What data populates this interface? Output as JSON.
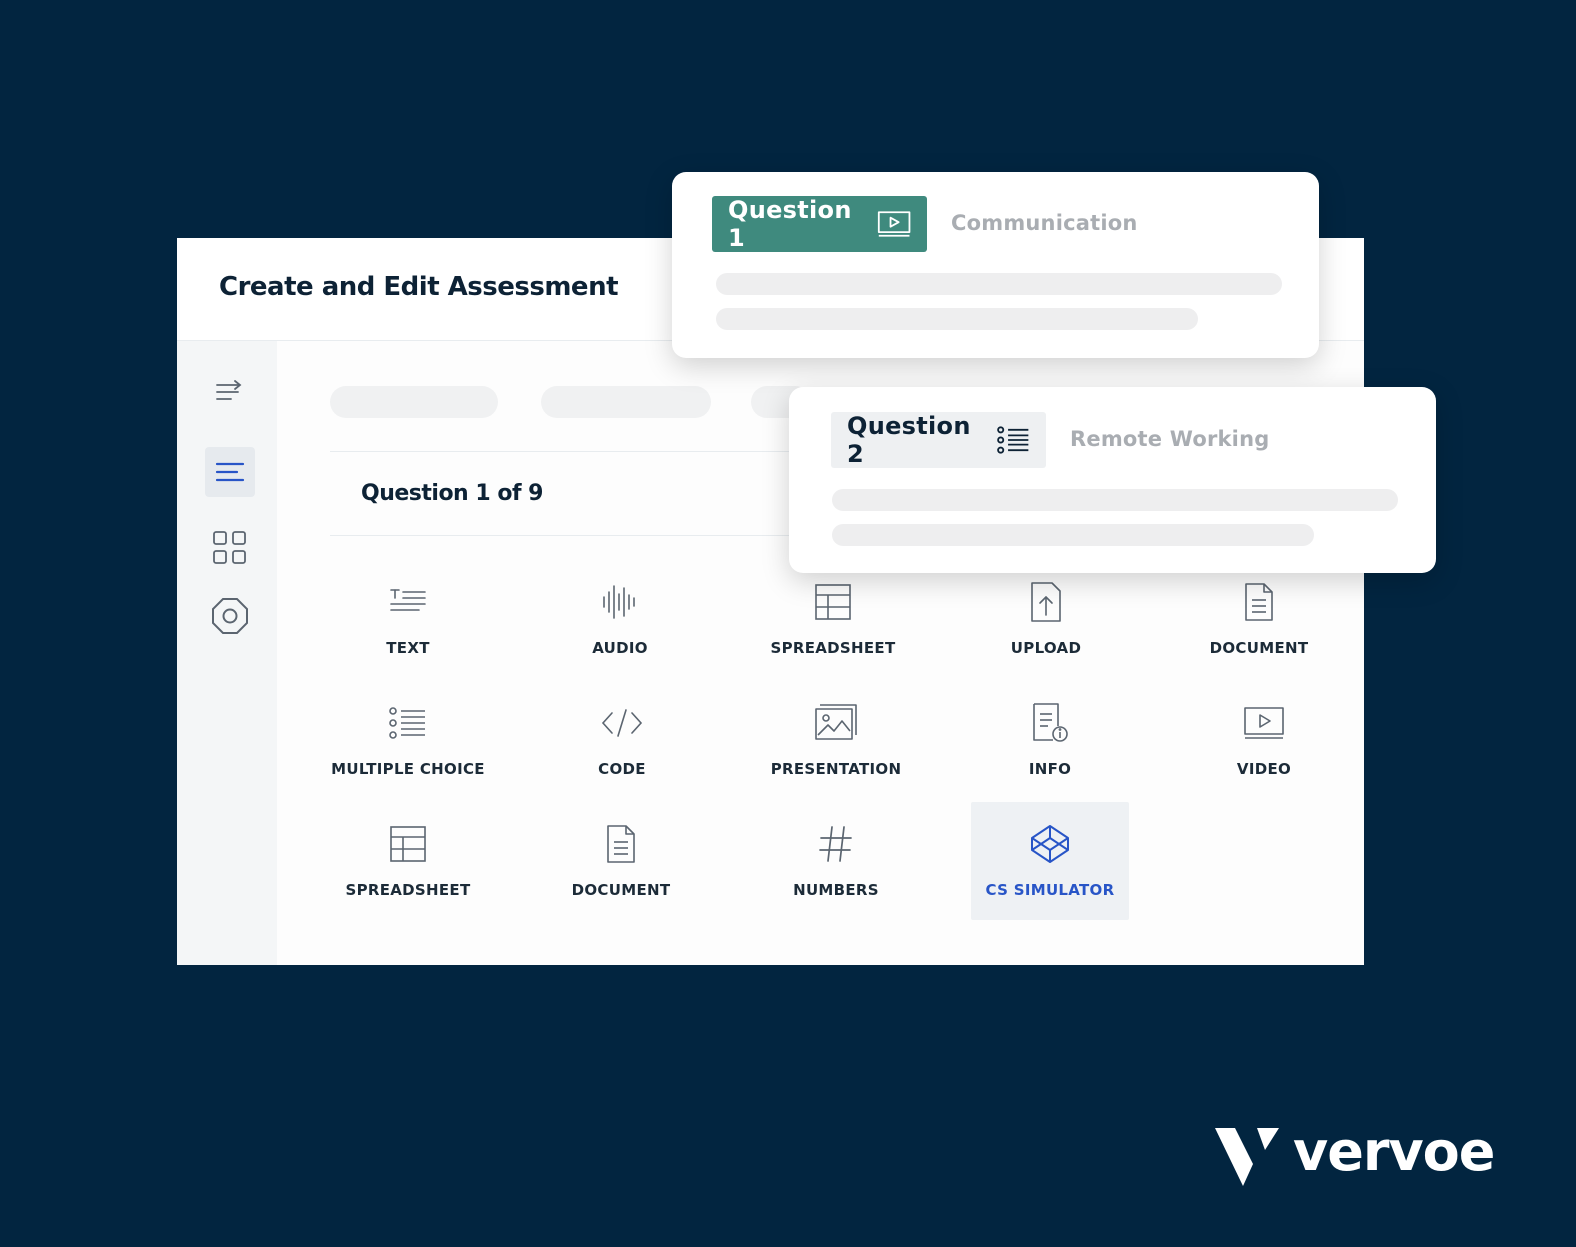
{
  "panel": {
    "title": "Create and Edit Assessment",
    "question_counter": "Question 1 of 9"
  },
  "sidebar": {
    "items": [
      {
        "icon": "indent-arrow-icon",
        "active": false
      },
      {
        "icon": "list-lines-icon",
        "active": true
      },
      {
        "icon": "grid-icon",
        "active": false
      },
      {
        "icon": "octagon-circle-icon",
        "active": false
      }
    ]
  },
  "question_types": {
    "row1": [
      "TEXT",
      "AUDIO",
      "SPREADSHEET",
      "UPLOAD",
      "DOCUMENT"
    ],
    "row2": [
      "MULTIPLE CHOICE",
      "CODE",
      "PRESENTATION",
      "INFO",
      "VIDEO"
    ],
    "row3": [
      "SPREADSHEET",
      "DOCUMENT",
      "NUMBERS",
      "CS SIMULATOR"
    ],
    "selected": "CS SIMULATOR"
  },
  "cards": {
    "q1": {
      "label": "Question 1",
      "category": "Communication",
      "icon": "video-play-icon",
      "color": "#3f8a7e"
    },
    "q2": {
      "label": "Question 2",
      "category": "Remote Working",
      "icon": "multiple-choice-list-icon"
    }
  },
  "colors": {
    "background": "#022540",
    "accent": "#2855c7",
    "teal": "#3f8a7e"
  },
  "brand": {
    "name": "vervoe"
  }
}
